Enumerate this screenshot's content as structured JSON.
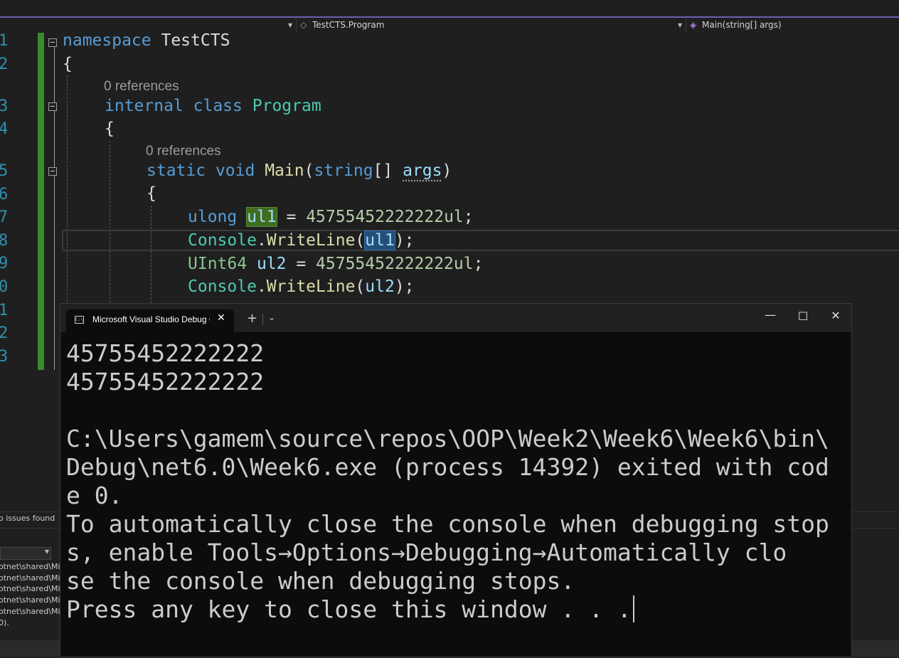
{
  "navbar": {
    "class_path": "TestCTS.Program",
    "member": "Main(string[] args)"
  },
  "editor": {
    "line_numbers": [
      "1",
      "2",
      "3",
      "4",
      "5",
      "6",
      "7",
      "8",
      "9",
      "0",
      "1",
      "2",
      "3"
    ],
    "codelens": [
      "0 references",
      "0 references"
    ],
    "lines": {
      "l1_kw": "namespace",
      "l1_name": "TestCTS",
      "l2": "{",
      "l3_kw1": "internal",
      "l3_kw2": "class",
      "l3_name": "Program",
      "l4": "{",
      "l5_kw1": "static",
      "l5_kw2": "void",
      "l5_fn": "Main",
      "l5_p1": "(",
      "l5_type": "string",
      "l5_p2": "[] ",
      "l5_arg": "args",
      "l5_p3": ")",
      "l6": "{",
      "l7_kw": "ulong",
      "l7_var": "ul1",
      "l7_eq": " = ",
      "l7_num": "45755452222222ul",
      "l7_end": ";",
      "l8_cls": "Console",
      "l8_dot": ".",
      "l8_fn": "WriteLine",
      "l8_p1": "(",
      "l8_var": "ul1",
      "l8_p2": ");",
      "l9_type": "UInt64",
      "l9_var": "ul2",
      "l9_eq": " = ",
      "l9_num": "45755452222222ul",
      "l9_end": ";",
      "l10_cls": "Console",
      "l10_dot": ".",
      "l10_fn": "WriteLine",
      "l10_p1": "(",
      "l10_var": "ul2",
      "l10_p2": ");"
    }
  },
  "status": {
    "issues": "o issues found"
  },
  "output_panel": {
    "lines": [
      "otnet\\shared\\Mic",
      "otnet\\shared\\Mic",
      "otnet\\shared\\Mic",
      "otnet\\shared\\Mic",
      "otnet\\shared\\Mic",
      "0)."
    ]
  },
  "console": {
    "tab_title": "Microsoft Visual Studio Debug Console",
    "lines": [
      "45755452222222",
      "45755452222222",
      "",
      "C:\\Users\\gamem\\source\\repos\\OOP\\Week2\\Week6\\Week6\\bin\\",
      "Debug\\net6.0\\Week6.exe (process 14392) exited with cod",
      "e 0.",
      "To automatically close the console when debugging stop",
      "s, enable Tools→Options→Debugging→Automatically clo",
      "se the console when debugging stops.",
      "Press any key to close this window . . ."
    ]
  },
  "colors": {
    "keyword": "#569cd6",
    "type": "#4ec9b0",
    "method": "#dcdcaa",
    "number": "#b5cea8",
    "variable": "#9cdcfe",
    "line_number": "#2b91af",
    "git_added": "#3c8a2e"
  }
}
